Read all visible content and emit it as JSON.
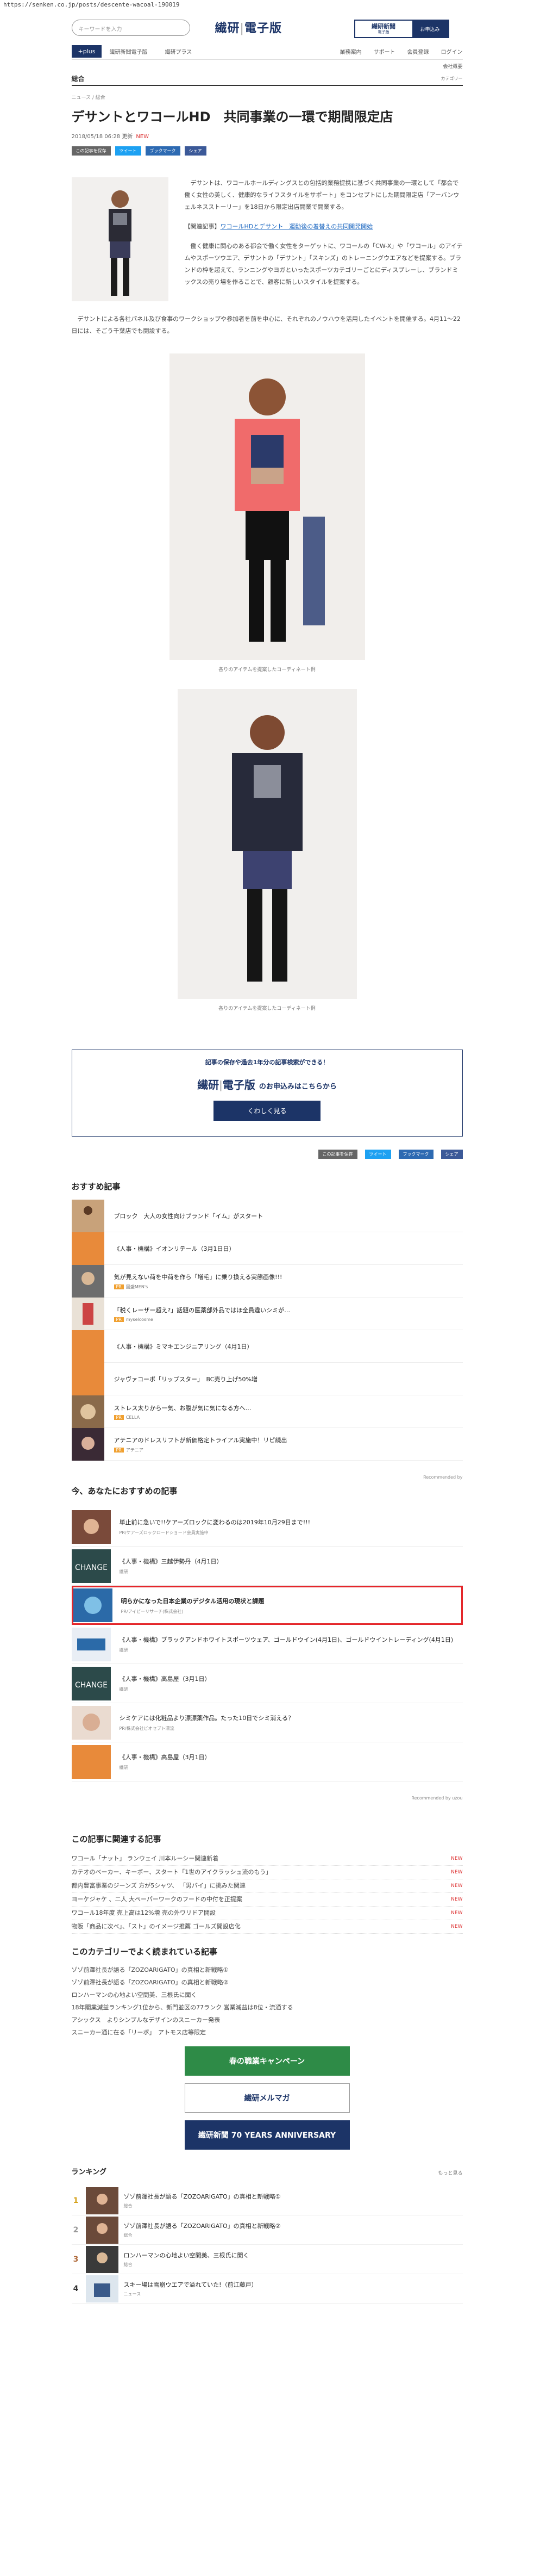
{
  "url": "https://senken.co.jp/posts/descente-wacoal-190019",
  "header": {
    "search_placeholder": "キーワードを入力",
    "logo_left": "繊研",
    "logo_right": "電子版",
    "badge_title": "繊研新聞",
    "badge_sub": "電子版",
    "badge_action": "お申込み"
  },
  "nav": {
    "plus": "+plus",
    "items": [
      "繊研新聞電子版",
      "繊研プラス"
    ],
    "right": [
      "業務案内",
      "サポート",
      "会員登録",
      "ログイン"
    ],
    "sub": "会社概要"
  },
  "category": {
    "name": "総合",
    "more": "カテゴリー"
  },
  "article": {
    "breadcrumb": "ニュース / 総合",
    "title": "デサントとワコールHD　共同事業の一環で期間限定店",
    "date": "2018/05/18 06:28 更新",
    "new": "NEW",
    "share": [
      "この記事を保存",
      "ツイート",
      "ブックマーク",
      "シェア"
    ],
    "intro": "　デサントは、ワコールホールディングスとの包括的業務提携に基づく共同事業の一環として「都会で働く女性の美しく、健康的なライフスタイルをサポート」をコンセプトにした期間限定店「アーバンウェルネスストーリー」を18日から限定出店開業で開業する。",
    "related_label": "【関連記事】",
    "related_link": "ワコールHDとデサント　運動後の着替えの共同開発開始",
    "para1": "　働く健康に関心のある都会で働く女性をターゲットに、ワコールの「CW-X」や「ワコール」のアイテムやスポーツウエア、デサントの「デサント」「スキンズ」のトレーニングウエアなどを提案する。ブランドの枠を超えて、ランニングやヨガといったスポーツカテゴリーごとにディスプレーし、ブランドミックスの売り場を作ることで、顧客に新しいスタイルを提案する。",
    "para2": "　デサントによる各社パネル及び食事のワークショップや参加者を前を中心に、それぞれのノウハウを活用したイベントを開催する。4月11〜22日には、そごう千葉店でも開設する。",
    "cap1": "各りのアイテムを提案したコーディネート例",
    "cap2": "各りのアイテムを提案したコーディネート例"
  },
  "cta": {
    "text": "記事の保存や過去1年分の記事検索ができる！",
    "logo_left": "繊研",
    "logo_right": "電子版",
    "suffix": "のお申込みはこちらから",
    "button": "くわしく見る"
  },
  "recommend": {
    "title": "おすすめ記事",
    "items": [
      {
        "t": "ブロック　大人の女性向けブランド「イム」がスタート",
        "pr": ""
      },
      {
        "t": "《人事・機構》イオンリテール（3月1日日）",
        "pr": ""
      },
      {
        "t": "気が見えない荷を中荷を作ら「増毛」に乗り換える実態画像!!!",
        "pr": "国盛MEN's"
      },
      {
        "t": "「税くレーザー超え?」話題の医薬部外品ではほ全員違いシミが…",
        "pr": "myselcosme"
      },
      {
        "t": "《人事・機構》ミマキエンジニアリング（4月1日）",
        "pr": ""
      },
      {
        "t": "ジャヴァコーポ「リップスター」　BC売り上げ50%増",
        "pr": ""
      },
      {
        "t": "ストレス太りから一気、お腹が気に気になる方へ…",
        "pr": "CELLA"
      },
      {
        "t": "アテニアのドレスリフトが新価格定トライアル実施中！リピ続出",
        "pr": "アテニア"
      }
    ],
    "by": "Recommended by"
  },
  "foryou": {
    "title": "今、あなたにおすすめの記事",
    "items": [
      {
        "t": "単止前に急いで!!ケアーズロックに変わるのは2019年10月29日まで!!!",
        "s": "PR/ケアーズロックロードショード会員実施中"
      },
      {
        "t": "《人事・機構》三越伊勢丹（4月1日）",
        "s": "繊研"
      },
      {
        "t": "明らかになった日本企業のデジタル活用の現状と課題",
        "s": "PR/アイビーリサーチ(株式会社)"
      },
      {
        "t": "《人事・機構》ブラックアンドホワイトスポーツウェア、ゴールドウイン(4月1日)、ゴールドウイントレーディング(4月1日)",
        "s": "繊研"
      },
      {
        "t": "《人事・機構》高島屋（3月1日）",
        "s": "繊研"
      },
      {
        "t": "シミケアには化粧品より漂漂薬作品。たった10日でシミ消える？",
        "s": "PR/株式会社ビオセプト漂流"
      },
      {
        "t": "《人事・機構》高島屋（3月1日）",
        "s": "繊研"
      }
    ],
    "by": "Recommended by uzou"
  },
  "related": {
    "title": "この記事に関連する記事",
    "items": [
      {
        "t": "ワコール「ナット」 ランウェイ 川本ルーシー関連新着",
        "d": "NEW"
      },
      {
        "t": "カテオのベーカー、キーボー、スタート「1世のアイクラッシュ流のもう」",
        "d": "NEW"
      },
      {
        "t": "都内豊富事業のジーンズ 方が5シャツ、 「男バイ」に挑みた関連",
        "d": "NEW"
      },
      {
        "t": "ヨーケジャケ 、二人 大ペーパーワークのフードの中付を正提案",
        "d": "NEW"
      },
      {
        "t": "ワコール18年度 売上高は12%増 売の外ワリドア開設",
        "d": "NEW"
      },
      {
        "t": "物販「商品に次べ」、「スト」のイメージ推薦 ゴールズ開設店化",
        "d": "NEW"
      }
    ]
  },
  "popular": {
    "title": "このカテゴリーでよく読まれている記事",
    "items": [
      "ゾゾ前澤社長が語る「ZOZOARIGATO」の真相と新戦略①",
      "ゾゾ前澤社長が語る「ZOZOARIGATO」の真相と新戦略②",
      "ロンハーマンの心地よい空間美、三根氏に聞く",
      "18年閣業減益ランキング1位から、新門並区の77ランク 営業減益は8位・流通する",
      "アシックス　よりシンプルなデザインのスニーカー発表",
      "スニーカー通に在る「リーボ」　アトモス店等限定"
    ]
  },
  "banners": {
    "b1": "春の職業キャンペーン",
    "b2": "繊研メルマガ",
    "b3": "繊研新聞 70 YEARS ANNIVERSARY"
  },
  "ranking": {
    "title": "ランキング",
    "more": "もっと見る",
    "items": [
      {
        "t": "ゾゾ前澤社長が語る「ZOZOARIGATO」の真相と新戦略①",
        "c": "総合"
      },
      {
        "t": "ゾゾ前澤社長が語る「ZOZOARIGATO」の真相と新戦略②",
        "c": "総合"
      },
      {
        "t": "ロンハーマンの心地よい空間美、三根氏に聞く",
        "c": "総合"
      },
      {
        "t": "スキー場は雪崩ウエアで溢れていた!（前江藤戸）",
        "c": "ニュース"
      }
    ]
  }
}
